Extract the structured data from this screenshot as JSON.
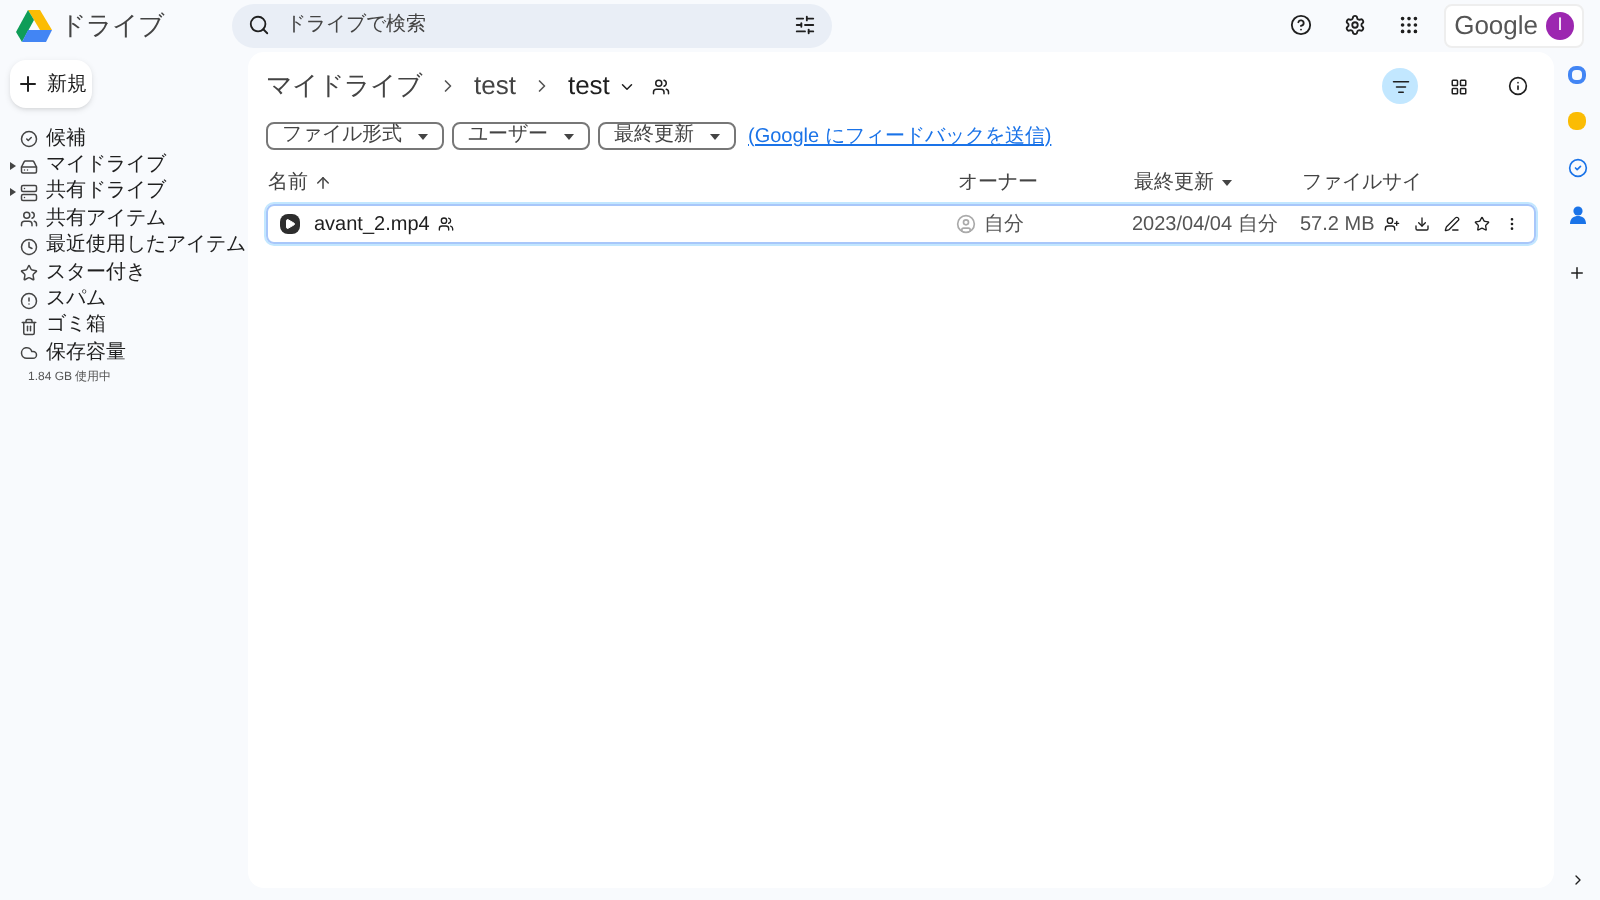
{
  "app": {
    "title": "ドライブ"
  },
  "search": {
    "placeholder": "ドライブで検索"
  },
  "account": {
    "brand": "Google",
    "initial": "I"
  },
  "new_button": {
    "label": "新規"
  },
  "sidebar": {
    "items": [
      {
        "kind": "suggested",
        "label": "候補",
        "expandable": false
      },
      {
        "kind": "mydrive",
        "label": "マイドライブ",
        "expandable": true
      },
      {
        "kind": "shareddrive",
        "label": "共有ドライブ",
        "expandable": true
      },
      {
        "kind": "shared",
        "label": "共有アイテム",
        "expandable": false
      },
      {
        "kind": "recent",
        "label": "最近使用したアイテム",
        "expandable": false
      },
      {
        "kind": "starred",
        "label": "スター付き",
        "expandable": false
      },
      {
        "kind": "spam",
        "label": "スパム",
        "expandable": false
      },
      {
        "kind": "trash",
        "label": "ゴミ箱",
        "expandable": false
      },
      {
        "kind": "storage",
        "label": "保存容量",
        "expandable": false
      }
    ],
    "storage_usage": "1.84 GB 使用中"
  },
  "breadcrumb": [
    "マイドライブ",
    "test",
    "test"
  ],
  "filters": [
    "ファイル形式",
    "ユーザー",
    "最終更新"
  ],
  "feedback_link": "(Google にフィードバックを送信)",
  "table": {
    "columns": [
      "名前",
      "オーナー",
      "最終更新",
      "ファイルサイ"
    ],
    "rows": [
      {
        "name": "avant_2.mp4",
        "owner": "自分",
        "modified": "2023/04/04 自分",
        "size": "57.2 MB",
        "selected": true
      }
    ]
  }
}
